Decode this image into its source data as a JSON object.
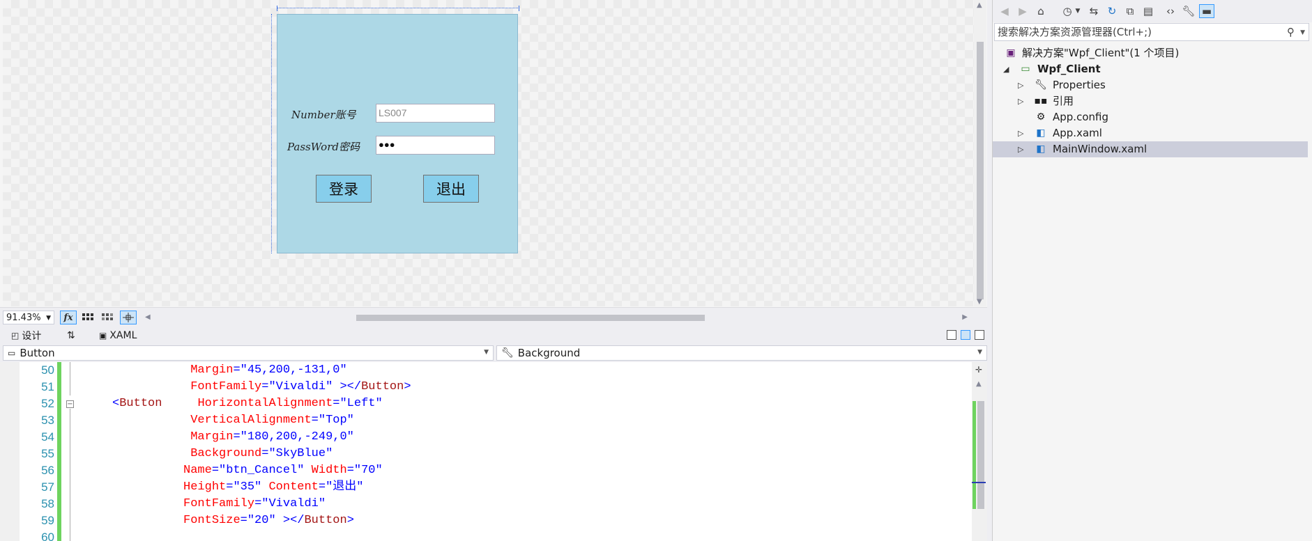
{
  "design": {
    "window": {
      "number_label": "Number账号",
      "number_value": "LS007",
      "password_label": "PassWord密码",
      "password_value": "●●●",
      "login_label": "登录",
      "exit_label": "退出"
    }
  },
  "design_bar": {
    "zoom": "91.43%",
    "fx_label": "fx"
  },
  "view_tabs": {
    "design": "设计",
    "swap": "⇅",
    "xaml": "XAML"
  },
  "nav": {
    "element": "Button",
    "property": "Background"
  },
  "code": {
    "lines": [
      {
        "n": "50",
        "indent": "                ",
        "parts": [
          [
            "attr",
            "Margin"
          ],
          [
            "val",
            "=\"45,200,-131,0\""
          ]
        ]
      },
      {
        "n": "51",
        "indent": "                ",
        "parts": [
          [
            "attr",
            "FontFamily"
          ],
          [
            "val",
            "=\"Vivaldi\" "
          ],
          [
            "val",
            "></"
          ],
          [
            "tag",
            "Button"
          ],
          [
            "val",
            ">"
          ]
        ]
      },
      {
        "n": "52",
        "indent": "     ",
        "parts": [
          [
            "val",
            "<"
          ],
          [
            "tag",
            "Button"
          ],
          [
            "attr",
            "     HorizontalAlignment"
          ],
          [
            "val",
            "=\"Left\""
          ]
        ]
      },
      {
        "n": "53",
        "indent": "                ",
        "parts": [
          [
            "attr",
            "VerticalAlignment"
          ],
          [
            "val",
            "=\"Top\""
          ]
        ]
      },
      {
        "n": "54",
        "indent": "                ",
        "parts": [
          [
            "attr",
            "Margin"
          ],
          [
            "val",
            "=\"180,200,-249,0\""
          ]
        ]
      },
      {
        "n": "55",
        "indent": "                ",
        "parts": [
          [
            "attr",
            "Background"
          ],
          [
            "val",
            "=\"SkyBlue\""
          ]
        ]
      },
      {
        "n": "56",
        "indent": "               ",
        "parts": [
          [
            "attr",
            "Name"
          ],
          [
            "val",
            "=\"btn_Cancel\""
          ],
          [
            "attr",
            " Width"
          ],
          [
            "val",
            "=\"70\""
          ]
        ]
      },
      {
        "n": "57",
        "indent": "               ",
        "parts": [
          [
            "attr",
            "Height"
          ],
          [
            "val",
            "=\"35\""
          ],
          [
            "attr",
            " Content"
          ],
          [
            "val",
            "=\"退出\""
          ]
        ]
      },
      {
        "n": "58",
        "indent": "               ",
        "parts": [
          [
            "attr",
            "FontFamily"
          ],
          [
            "val",
            "=\"Vivaldi\""
          ]
        ]
      },
      {
        "n": "59",
        "indent": "               ",
        "parts": [
          [
            "attr",
            "FontSize"
          ],
          [
            "val",
            "=\"20\" "
          ],
          [
            "val",
            "></"
          ],
          [
            "tag",
            "Button"
          ],
          [
            "val",
            ">"
          ]
        ]
      },
      {
        "n": "60",
        "indent": "",
        "parts": []
      }
    ]
  },
  "solution_explorer": {
    "search_placeholder": "搜索解决方案资源管理器(Ctrl+;)",
    "items": [
      {
        "label": "解决方案\"Wpf_Client\"(1 个项目)"
      },
      {
        "label": "Wpf_Client"
      },
      {
        "label": "Properties"
      },
      {
        "label": "引用"
      },
      {
        "label": "App.config"
      },
      {
        "label": "App.xaml"
      },
      {
        "label": "MainWindow.xaml"
      }
    ]
  }
}
